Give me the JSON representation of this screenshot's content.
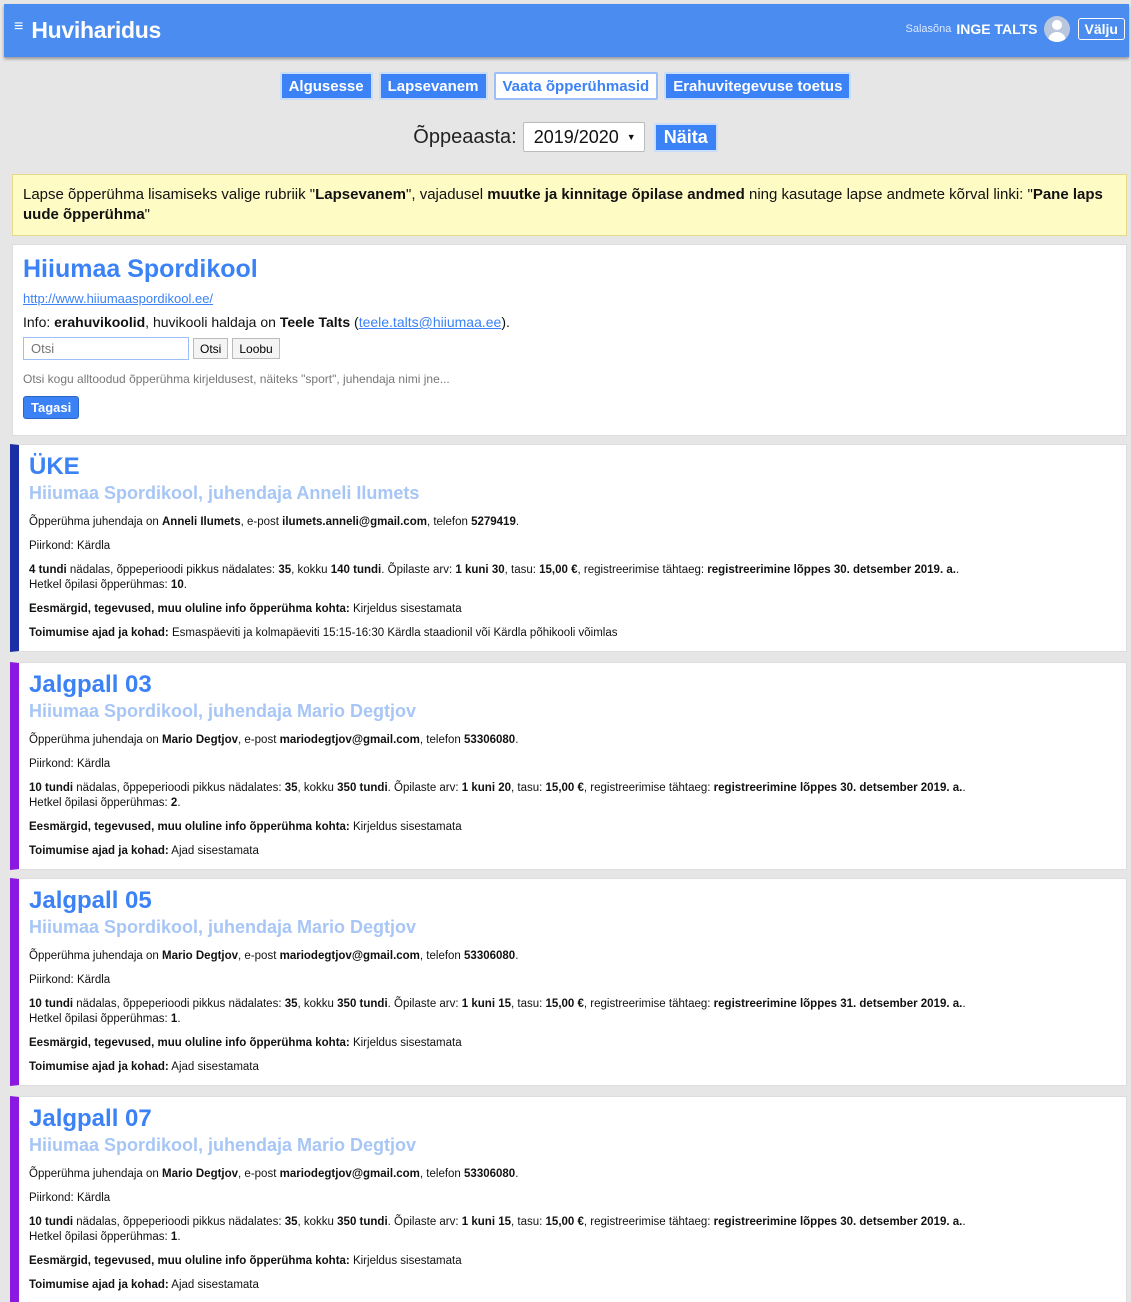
{
  "header": {
    "menu_icon": "≡",
    "app_title": "Huviharidus",
    "password_link": "Salasõna",
    "user_name": "INGE TALTS",
    "logout_label": "Välju"
  },
  "nav": {
    "home": "Algusesse",
    "parent": "Lapsevanem",
    "view_groups": "Vaata õpperühmasid",
    "support": "Erahuvitegevuse toetus"
  },
  "year": {
    "label": "Õppeaasta:",
    "selected": "2019/2020",
    "show_button": "Näita"
  },
  "notice": {
    "t1": "Lapse õpperühma lisamiseks valige rubriik \"",
    "b1": "Lapsevanem",
    "t2": "\", vajadusel ",
    "b2": "muutke ja kinnitage õpilase andmed",
    "t3": " ning kasutage lapse andmete kõrval linki: \"",
    "b3": "Pane laps uude õpperühma",
    "t4": "\""
  },
  "school": {
    "name": "Hiiumaa Spordikool",
    "url": "http://www.hiiumaaspordikool.ee/",
    "info_prefix": "Info: ",
    "type": "erahuvikoolid",
    "manager_text": ", huvikooli haldaja on ",
    "manager": "Teele Talts",
    "open_paren": " (",
    "email": "teele.talts@hiiumaa.ee",
    "close_paren": ").",
    "search_placeholder": "Otsi",
    "search_button": "Otsi",
    "cancel_button": "Loobu",
    "search_hint": "Otsi kogu alltoodud õpperühma kirjeldusest, näiteks \"sport\", juhendaja nimi jne...",
    "back_button": "Tagasi"
  },
  "labels": {
    "leader_prefix": "Õpperühma juhendaja on ",
    "email_prefix": ", e-post ",
    "phone_prefix": ", telefon ",
    "end_dot": ".",
    "region_prefix": "Piirkond: ",
    "hours_suffix": " nädalas, õppeperioodi pikkus nädalates: ",
    "total_prefix": ", kokku ",
    "students_prefix": ". Õpilaste arv: ",
    "fee_prefix": ", tasu: ",
    "deadline_prefix": ", registreerimise tähtaeg: ",
    "deadline_suffix": ".",
    "current_prefix": "Hetkel õpilasi õpperühmas: ",
    "goals_label": "Eesmärgid, tegevused, muu oluline info õpperühma kohta:",
    "times_label": "Toimumise ajad ja kohad:"
  },
  "groups": [
    {
      "name": "ÜKE",
      "subtitle": "Hiiumaa Spordikool, juhendaja Anneli Ilumets",
      "leader": "Anneli Ilumets",
      "email": "ilumets.anneli@gmail.com",
      "phone": "5279419",
      "region": "Kärdla",
      "hours": "4 tundi",
      "weeks": "35",
      "total": "140 tundi",
      "students": "1 kuni 30",
      "fee": "15,00 €",
      "deadline": "registreerimine lõppes 30. detsember 2019. a.",
      "current": "10",
      "goals": " Kirjeldus sisestamata",
      "times": " Esmaspäeviti ja kolmapäeviti 15:15-16:30 Kärdla staadionil või Kärdla põhikooli võimlas"
    },
    {
      "name": "Jalgpall 03",
      "subtitle": "Hiiumaa Spordikool, juhendaja Mario Degtjov",
      "leader": "Mario Degtjov",
      "email": "mariodegtjov@gmail.com",
      "phone": "53306080",
      "region": "Kärdla",
      "hours": "10 tundi",
      "weeks": "35",
      "total": "350 tundi",
      "students": "1 kuni 20",
      "fee": "15,00 €",
      "deadline": "registreerimine lõppes 30. detsember 2019. a.",
      "current": "2",
      "goals": " Kirjeldus sisestamata",
      "times": " Ajad sisestamata"
    },
    {
      "name": "Jalgpall 05",
      "subtitle": "Hiiumaa Spordikool, juhendaja Mario Degtjov",
      "leader": "Mario Degtjov",
      "email": "mariodegtjov@gmail.com",
      "phone": "53306080",
      "region": "Kärdla",
      "hours": "10 tundi",
      "weeks": "35",
      "total": "350 tundi",
      "students": "1 kuni 15",
      "fee": "15,00 €",
      "deadline": "registreerimine lõppes 31. detsember 2019. a.",
      "current": "1",
      "goals": " Kirjeldus sisestamata",
      "times": " Ajad sisestamata"
    },
    {
      "name": "Jalgpall 07",
      "subtitle": "Hiiumaa Spordikool, juhendaja Mario Degtjov",
      "leader": "Mario Degtjov",
      "email": "mariodegtjov@gmail.com",
      "phone": "53306080",
      "region": "Kärdla",
      "hours": "10 tundi",
      "weeks": "35",
      "total": "350 tundi",
      "students": "1 kuni 15",
      "fee": "15,00 €",
      "deadline": "registreerimine lõppes 30. detsember 2019. a.",
      "current": "1",
      "goals": " Kirjeldus sisestamata",
      "times": " Ajad sisestamata"
    }
  ],
  "colors": {
    "primary": "#3b82f6",
    "topbar": "#4a8cf0",
    "subtitle": "#a7c6f6",
    "notice_bg": "#fffbc4",
    "accent_dark_blue": "#1a2ea5",
    "accent_purple": "#8a18e0"
  }
}
